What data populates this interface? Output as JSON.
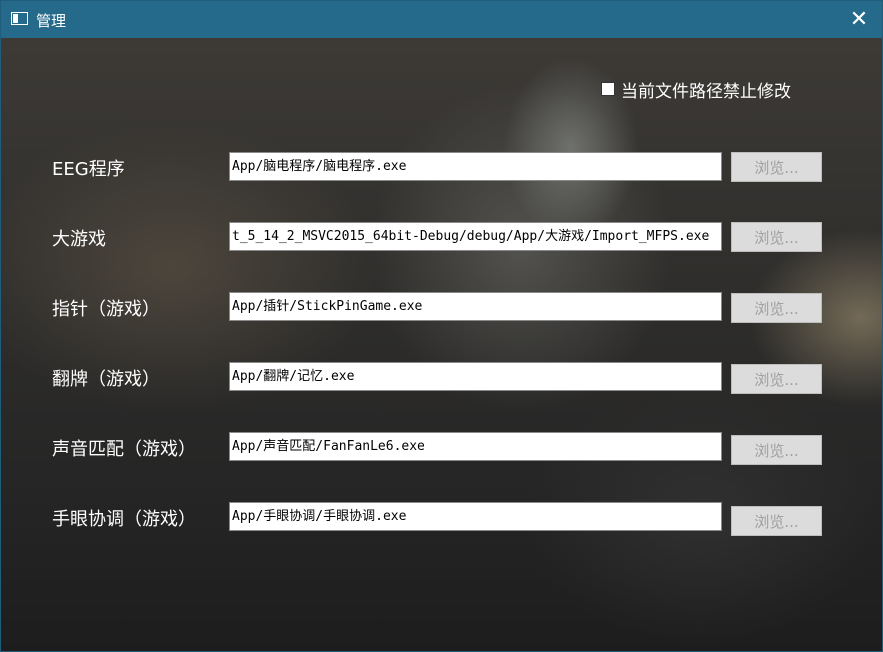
{
  "window": {
    "title": "管理",
    "icon": "window-app-icon",
    "close_glyph": "✕"
  },
  "lock": {
    "label": "当前文件路径禁止修改",
    "checked": false
  },
  "rows": [
    {
      "label": "EEG程序",
      "path": "App/脑电程序/脑电程序.exe",
      "button": "浏览..."
    },
    {
      "label": "大游戏",
      "path": "t_5_14_2_MSVC2015_64bit-Debug/debug/App/大游戏/Import_MFPS.exe",
      "button": "浏览..."
    },
    {
      "label": "指针（游戏）",
      "path": "App/插针/StickPinGame.exe",
      "button": "浏览..."
    },
    {
      "label": "翻牌（游戏）",
      "path": "App/翻牌/记忆.exe",
      "button": "浏览..."
    },
    {
      "label": "声音匹配（游戏）",
      "path": "App/声音匹配/FanFanLe6.exe",
      "button": "浏览..."
    },
    {
      "label": "手眼协调（游戏）",
      "path": "App/手眼协调/手眼协调.exe",
      "button": "浏览..."
    }
  ],
  "colors": {
    "titlebar": "#256a8a",
    "button_bg": "#dcdcdc",
    "button_text": "#a0a0a0"
  }
}
